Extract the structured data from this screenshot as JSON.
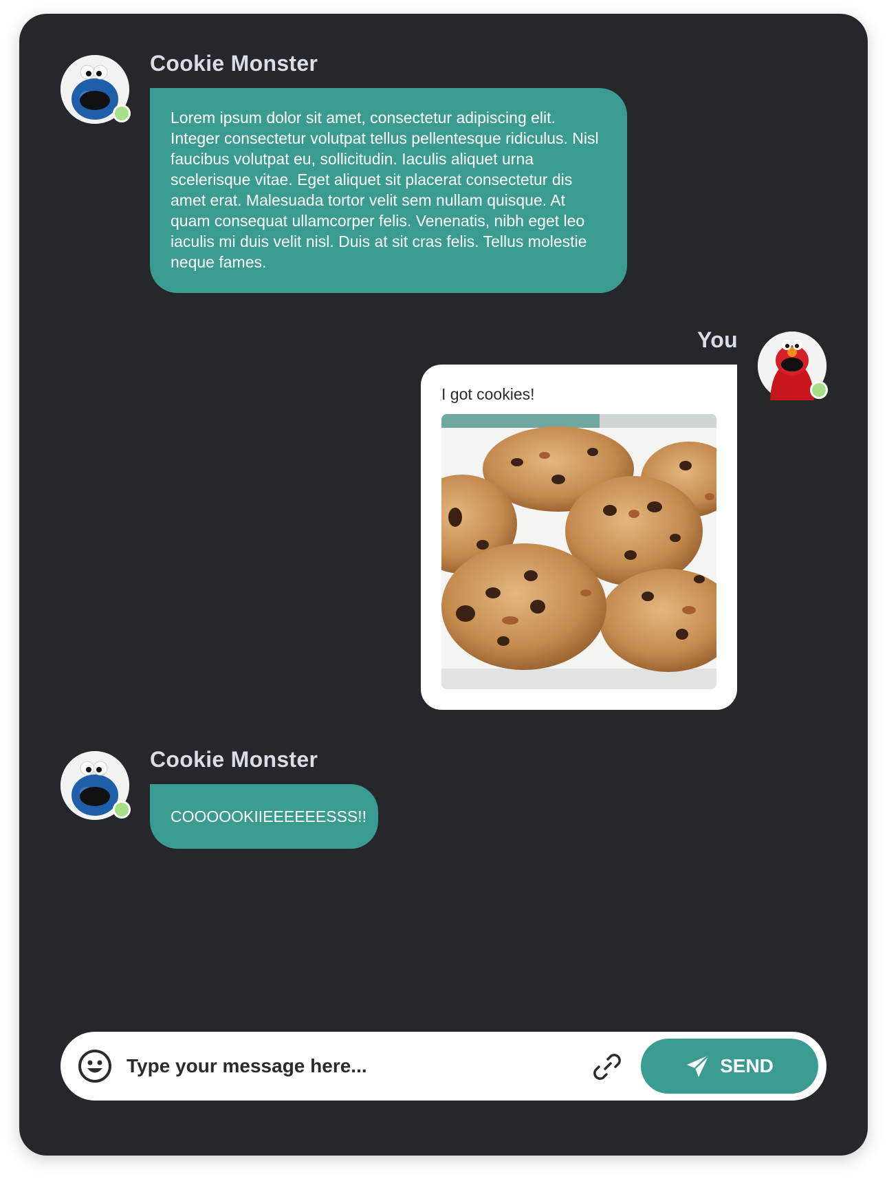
{
  "theme": {
    "background": "#26272b",
    "accent": "#3a9b91",
    "presence": "#a6e086",
    "name_color": "#d9dde6"
  },
  "messages": [
    {
      "sender": "Cookie Monster",
      "avatar_icon": "cookie-monster-avatar",
      "online": true,
      "text": "Lorem ipsum dolor sit amet, consectetur adipiscing elit. Integer consectetur volutpat tellus pellentesque ridiculus. Nisl faucibus volutpat eu, sollicitudin. Iaculis aliquet urna scelerisque vitae. Eget aliquet sit placerat consectetur dis amet erat. Malesuada tortor velit sem nullam quisque. At quam consequat ullamcorper felis. Venenatis, nibh eget leo iaculis mi duis velit nisl. Duis at sit cras felis. Tellus molestie neque fames."
    },
    {
      "sender": "You",
      "avatar_icon": "elmo-avatar",
      "online": true,
      "text": "I got cookies!",
      "attachment": "cookies-photo"
    },
    {
      "sender": "Cookie Monster",
      "avatar_icon": "cookie-monster-avatar",
      "online": true,
      "text": "COOOOOKIIEEEEEESSS!!"
    }
  ],
  "composer": {
    "emoji_icon": "smiley-icon",
    "placeholder": "Type your message here...",
    "attach_icon": "link-icon",
    "send_icon": "paper-plane-icon",
    "send_label": "SEND"
  }
}
